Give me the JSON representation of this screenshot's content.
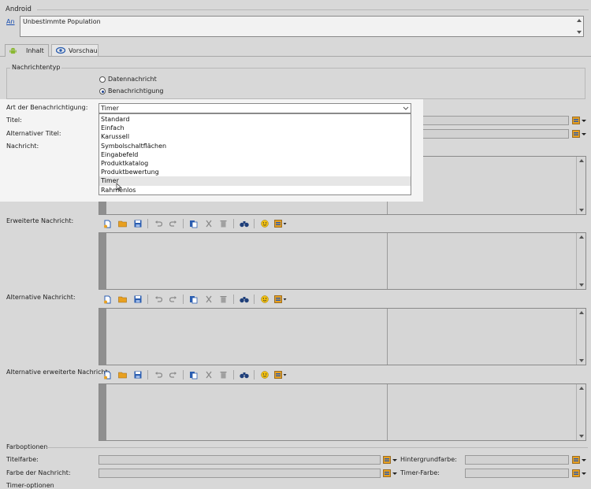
{
  "section_title": "Android",
  "audience": {
    "link": "An",
    "value": "Unbestimmte Population"
  },
  "tabs": [
    {
      "label": "Inhalt"
    },
    {
      "label": "Vorschau"
    }
  ],
  "message_type": {
    "legend": "Nachrichtentyp",
    "options": [
      {
        "label": "Datennachricht",
        "selected": false
      },
      {
        "label": "Benachrichtigung",
        "selected": true
      }
    ]
  },
  "notification_type": {
    "label": "Art der Benachrichtigung:",
    "selected": "Timer",
    "options": [
      "Standard",
      "Einfach",
      "Karussell",
      "Symbolschaltflächen",
      "Eingabefeld",
      "Produktkatalog",
      "Produktbewertung",
      "Timer",
      "Rahmenlos"
    ],
    "hovered": "Timer"
  },
  "fields": {
    "title": "Titel:",
    "alt_title": "Alternativer Titel:",
    "message": "Nachricht:",
    "extended_message": "Erweiterte Nachricht:",
    "alt_message": "Alternative Nachricht:",
    "alt_extended_message": "Alternative erweiterte Nachricht:"
  },
  "color_options": {
    "legend": "Farboptionen",
    "title_color": "Titelfarbe:",
    "background_color": "Hintergrundfarbe:",
    "message_color": "Farbe der Nachricht:",
    "timer_color": "Timer-Farbe:",
    "next_section": "Timer-optionen"
  },
  "colors": {
    "link": "#1a4fb0",
    "accent_orange": "#e8a020",
    "accent_blue": "#2a5db0",
    "highlight_panel": "#f4f4f4"
  }
}
